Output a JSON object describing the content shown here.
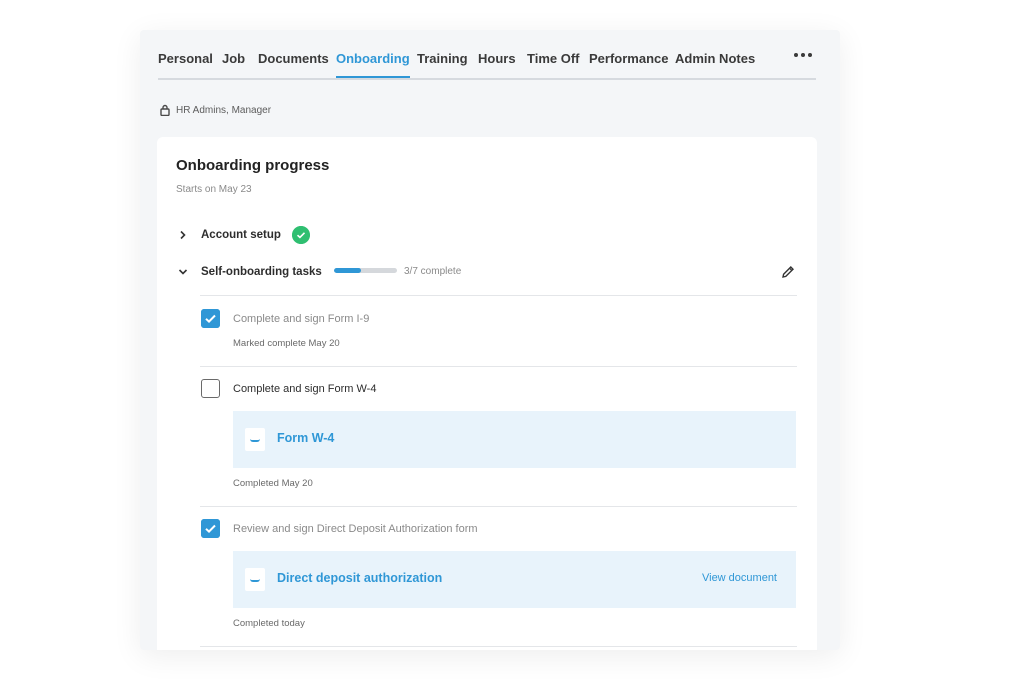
{
  "tabs": [
    "Personal",
    "Job",
    "Documents",
    "Onboarding",
    "Training",
    "Hours",
    "Time Off",
    "Performance",
    "Admin Notes"
  ],
  "active_tab": "Onboarding",
  "access": {
    "label": "HR Admins, Manager",
    "icon": "lock-icon"
  },
  "card": {
    "title": "Onboarding progress",
    "subtitle": "Starts on May 23"
  },
  "account_setup": {
    "label": "Account setup",
    "status_icon": "check-circle-icon",
    "status_color": "#2fbf71"
  },
  "self_onboarding": {
    "label": "Self-onboarding tasks",
    "progress_text": "3/7 complete",
    "progress_fraction": 0.43
  },
  "tasks": [
    {
      "label": "Complete and sign Form I-9",
      "checked": true,
      "note": "Marked complete May 20"
    },
    {
      "label": "Complete and sign Form W-4",
      "checked": false,
      "document": "Form W-4",
      "note": "Completed May 20"
    },
    {
      "label": "Review and sign Direct Deposit Authorization form",
      "checked": true,
      "document": "Direct deposit authorization",
      "document_link": "View document",
      "note": "Completed today"
    }
  ],
  "colors": {
    "accent": "#2f97d6",
    "success": "#2fbf71",
    "doc_background": "#e8f3fb"
  }
}
